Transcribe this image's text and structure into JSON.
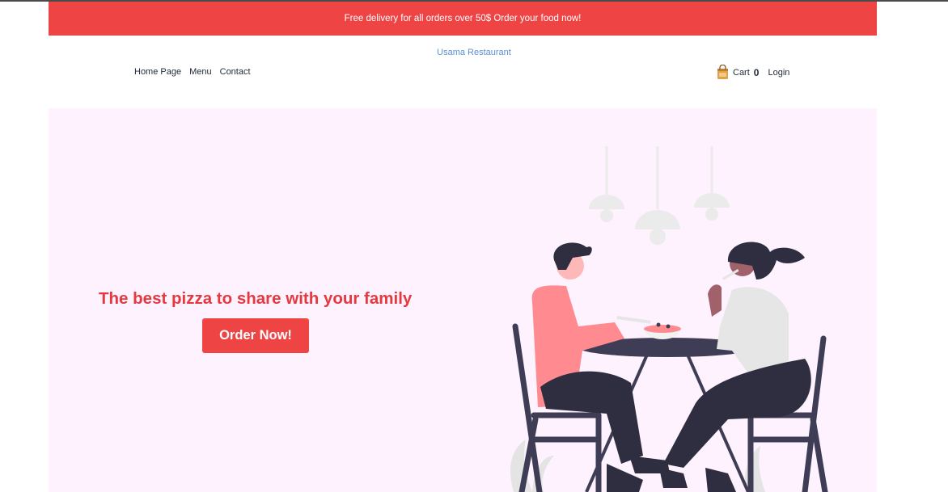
{
  "promo": {
    "text": "Free delivery for all orders over 50$ Order your food now!"
  },
  "header": {
    "brand": "Usama Restaurant",
    "nav": [
      {
        "label": "Home Page"
      },
      {
        "label": "Menu"
      },
      {
        "label": "Contact"
      }
    ],
    "cart_label": "Cart",
    "cart_count": "0",
    "login_label": "Login",
    "cart_icon": "shopping-bag-icon"
  },
  "hero": {
    "tagline": "The best pizza to share with your family",
    "cta_label": "Order Now!",
    "illustration": "couple-dining-illustration"
  },
  "colors": {
    "accent": "#ef4444",
    "hero_bg": "#fdf2fd",
    "brand_link": "#5b8fd6",
    "illustration_dark": "#3f3d56",
    "illustration_pink": "#ff8a8f"
  }
}
